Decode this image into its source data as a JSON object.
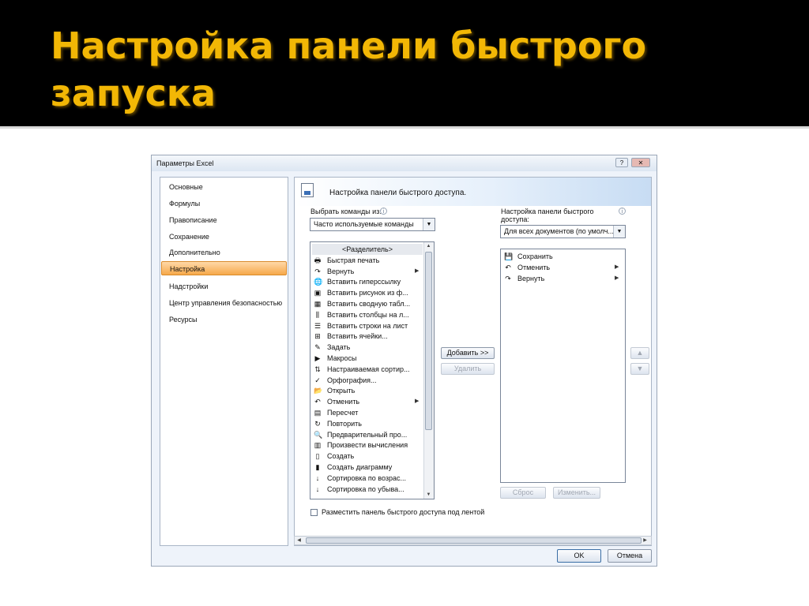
{
  "slide": {
    "title": "Настройка панели быстрого запуска"
  },
  "dialog": {
    "title": "Параметры Excel",
    "help_icon": "question-icon",
    "close_icon": "close-icon",
    "help_label": "?",
    "close_label": "✕",
    "nav": [
      {
        "label": "Основные",
        "active": false
      },
      {
        "label": "Формулы",
        "active": false
      },
      {
        "label": "Правописание",
        "active": false
      },
      {
        "label": "Сохранение",
        "active": false
      },
      {
        "label": "Дополнительно",
        "active": false
      },
      {
        "label": "Настройка",
        "active": true
      },
      {
        "label": "Надстройки",
        "active": false
      },
      {
        "label": "Центр управления безопасностью",
        "active": false
      },
      {
        "label": "Ресурсы",
        "active": false
      }
    ],
    "header": {
      "text": "Настройка панели быстрого доступа."
    },
    "choose_label": "Выбрать команды из:",
    "choose_value": "Часто используемые команды",
    "customize_label_line1": "Настройка панели быстрого",
    "customize_label_line2": "доступа:",
    "customize_value": "Для всех документов (по умолч...",
    "commands": [
      {
        "label": "<Разделитель>",
        "icon": "separator",
        "glyph": "",
        "submenu": false
      },
      {
        "label": "Быстрая печать",
        "icon": "printer-icon",
        "glyph": "🖶",
        "submenu": false
      },
      {
        "label": "Вернуть",
        "icon": "redo-icon",
        "glyph": "↷",
        "submenu": true
      },
      {
        "label": "Вставить гиперссылку",
        "icon": "hyperlink-icon",
        "glyph": "🌐",
        "submenu": false
      },
      {
        "label": "Вставить рисунок из ф...",
        "icon": "picture-icon",
        "glyph": "▣",
        "submenu": false
      },
      {
        "label": "Вставить сводную табл...",
        "icon": "pivot-table-icon",
        "glyph": "▦",
        "submenu": false
      },
      {
        "label": "Вставить столбцы на л...",
        "icon": "insert-columns-icon",
        "glyph": "⫼",
        "submenu": false
      },
      {
        "label": "Вставить строки на лист",
        "icon": "insert-rows-icon",
        "glyph": "☰",
        "submenu": false
      },
      {
        "label": "Вставить ячейки...",
        "icon": "insert-cells-icon",
        "glyph": "⊞",
        "submenu": false
      },
      {
        "label": "Задать",
        "icon": "define-icon",
        "glyph": "✎",
        "submenu": false
      },
      {
        "label": "Макросы",
        "icon": "macro-play-icon",
        "glyph": "▶",
        "submenu": false
      },
      {
        "label": "Настраиваемая сортир...",
        "icon": "custom-sort-icon",
        "glyph": "⇅",
        "submenu": false
      },
      {
        "label": "Орфография...",
        "icon": "spelling-icon",
        "glyph": "✓",
        "submenu": false
      },
      {
        "label": "Открыть",
        "icon": "open-folder-icon",
        "glyph": "📂",
        "submenu": false
      },
      {
        "label": "Отменить",
        "icon": "undo-icon",
        "glyph": "↶",
        "submenu": true
      },
      {
        "label": "Пересчет",
        "icon": "recalc-icon",
        "glyph": "▤",
        "submenu": false
      },
      {
        "label": "Повторить",
        "icon": "repeat-icon",
        "glyph": "↻",
        "submenu": false
      },
      {
        "label": "Предварительный про...",
        "icon": "print-preview-icon",
        "glyph": "🔍",
        "submenu": false
      },
      {
        "label": "Произвести вычисления",
        "icon": "calculate-icon",
        "glyph": "▥",
        "submenu": false
      },
      {
        "label": "Создать",
        "icon": "new-document-icon",
        "glyph": "▯",
        "submenu": false
      },
      {
        "label": "Создать диаграмму",
        "icon": "chart-icon",
        "glyph": "▮",
        "submenu": false
      },
      {
        "label": "Сортировка по возрас...",
        "icon": "sort-ascending-icon",
        "glyph": "↓",
        "submenu": false
      },
      {
        "label": "Сортировка по убыва...",
        "icon": "sort-descending-icon",
        "glyph": "↓",
        "submenu": false
      }
    ],
    "toolbar_items": [
      {
        "label": "Сохранить",
        "icon": "save-icon",
        "glyph": "💾",
        "submenu": false
      },
      {
        "label": "Отменить",
        "icon": "undo-icon",
        "glyph": "↶",
        "submenu": true
      },
      {
        "label": "Вернуть",
        "icon": "redo-icon",
        "glyph": "↷",
        "submenu": true
      }
    ],
    "add_button": "Добавить >>",
    "remove_button": "Удалить",
    "reset_button": "Сброс",
    "modify_button": "Изменить...",
    "move_up_glyph": "▲",
    "move_down_glyph": "▼",
    "checkbox_label": "Разместить панель быстрого доступа под лентой",
    "info_glyph": "i",
    "ok_button": "OK",
    "cancel_button": "Отмена"
  }
}
